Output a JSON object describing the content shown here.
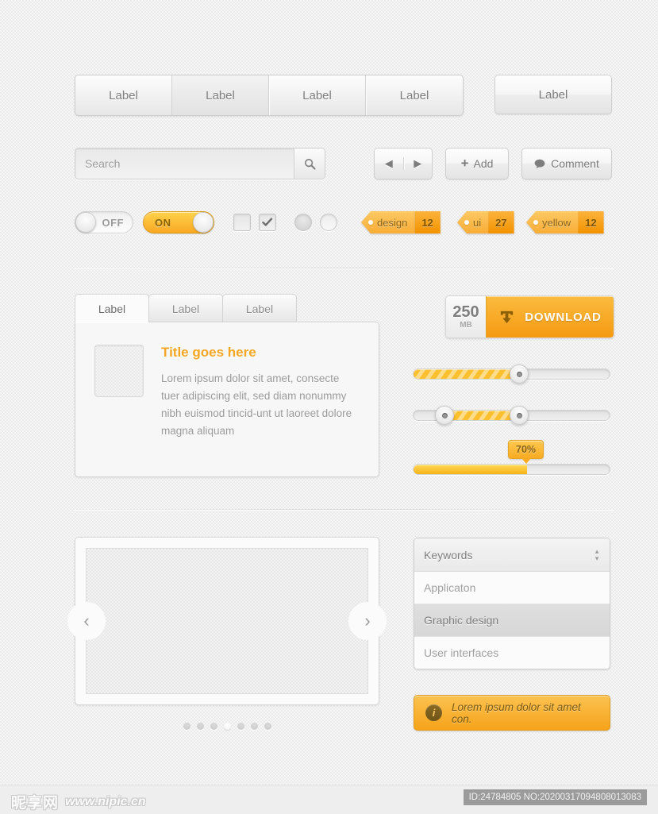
{
  "segmented": {
    "items": [
      {
        "label": "Label",
        "active": false
      },
      {
        "label": "Label",
        "active": true
      },
      {
        "label": "Label",
        "active": false
      },
      {
        "label": "Label",
        "active": false
      }
    ],
    "solo_label": "Label"
  },
  "search": {
    "value": "",
    "placeholder": "Search",
    "icon": "magnifier-icon"
  },
  "actions": {
    "prev_icon": "◀",
    "next_icon": "▶",
    "add_label": "Add",
    "add_icon": "+",
    "comment_label": "Comment",
    "comment_icon": "speech-bubble-icon"
  },
  "toggles": {
    "off_label": "OFF",
    "on_label": "ON"
  },
  "tags": [
    {
      "label": "design",
      "count": "12"
    },
    {
      "label": "ui",
      "count": "27"
    },
    {
      "label": "yellow",
      "count": "12"
    }
  ],
  "tabpanel": {
    "tabs": [
      {
        "label": "Label",
        "active": true
      },
      {
        "label": "Label",
        "active": false
      },
      {
        "label": "Label",
        "active": false
      }
    ],
    "title": "Title goes here",
    "body": "Lorem ipsum dolor sit amet, consecte tuer adipiscing elit, sed diam nonummy nibh euismod tincid-unt ut laoreet dolore magna aliquam"
  },
  "download": {
    "size": "250",
    "unit": "MB",
    "label": "DOWNLOAD",
    "icon": "download-tray-icon"
  },
  "sliders": [
    {
      "name": "single-handle-slider",
      "fill_start_pct": 0,
      "fill_end_pct": 52,
      "handles": [
        52
      ],
      "striped": true
    },
    {
      "name": "range-slider",
      "fill_start_pct": 14,
      "fill_end_pct": 52,
      "handles": [
        14,
        52
      ],
      "striped": true
    },
    {
      "name": "progress-slider",
      "fill_start_pct": 0,
      "fill_end_pct": 58,
      "tooltip": "70%",
      "striped": false
    }
  ],
  "carousel": {
    "prev_icon": "‹",
    "next_icon": "›",
    "dot_count": 7,
    "active_dot": 4
  },
  "select": {
    "header": "Keywords",
    "items": [
      {
        "label": "Applicaton",
        "selected": false
      },
      {
        "label": "Graphic design",
        "selected": true
      },
      {
        "label": "User interfaces",
        "selected": false
      }
    ]
  },
  "notification": {
    "icon": "info-icon",
    "icon_glyph": "i",
    "text": "Lorem ipsum dolor sit amet con."
  },
  "footer": {
    "watermark_cn": "昵享网",
    "watermark_url": "www.nipic.cn",
    "id_text": "ID:24784805 NO:20200317094808013083"
  },
  "colors": {
    "accent_orange": "#f5a623",
    "accent_orange_dark": "#f39200",
    "text_gray": "#8f8f8f",
    "background": "#ebebeb"
  }
}
